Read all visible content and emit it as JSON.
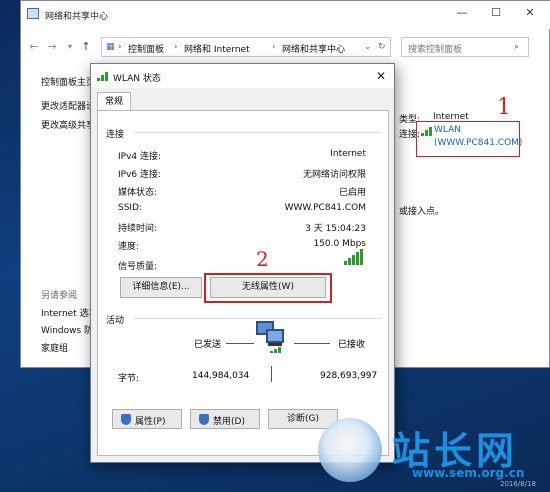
{
  "bg_window": {
    "title": "网络和共享中心",
    "minimize": "—",
    "maximize": "☐",
    "close": "✕",
    "breadcrumb": [
      "控制面板",
      "网络和 Internet",
      "网络和共享中心"
    ],
    "breadcrumb_sep": "›",
    "search_placeholder": "搜索控制面板",
    "left_links": [
      "控制面板主页",
      "更改适配器设",
      "更改高级共享"
    ],
    "see_also_label": "另请参阅",
    "see_also_links": [
      "Internet 选项",
      "Windows 防",
      "家庭组"
    ],
    "access_type_label": "类型:",
    "access_type_value": "Internet",
    "connection_prefix": "连接:",
    "connection_link_1": "WLAN",
    "connection_link_2": "(WWW.PC841.COM)",
    "hint_text": "或接入点。"
  },
  "dialog": {
    "title": "WLAN 状态",
    "close": "✕",
    "tab_label": "常规",
    "connection_group": "连接",
    "rows": [
      {
        "label": "IPv4 连接:",
        "value": "Internet"
      },
      {
        "label": "IPv6 连接:",
        "value": "无网络访问权限"
      },
      {
        "label": "媒体状态:",
        "value": "已启用"
      },
      {
        "label": "SSID:",
        "value": "WWW.PC841.COM"
      },
      {
        "label": "持续时间:",
        "value": "3 天 15:04:23"
      },
      {
        "label": "速度:",
        "value": "150.0 Mbps"
      }
    ],
    "signal_label": "信号质量:",
    "signal_level": 5,
    "details_button": "详细信息(E)...",
    "wireless_props_button": "无线属性(W)",
    "activity_group": "活动",
    "sent_label": "已发送",
    "received_label": "已接收",
    "bytes_label": "字节:",
    "bytes_sent": "144,984,034",
    "bytes_received": "928,693,997",
    "properties_button": "属性(P)",
    "disable_button": "禁用(D)",
    "diagnose_button": "诊断(G)"
  },
  "annotations": {
    "marker_1": "1",
    "marker_2": "2",
    "color": "#d02020"
  },
  "watermark": {
    "brand": "站长网",
    "url": "www.sem.org.cn",
    "date": "2016/8/18"
  }
}
